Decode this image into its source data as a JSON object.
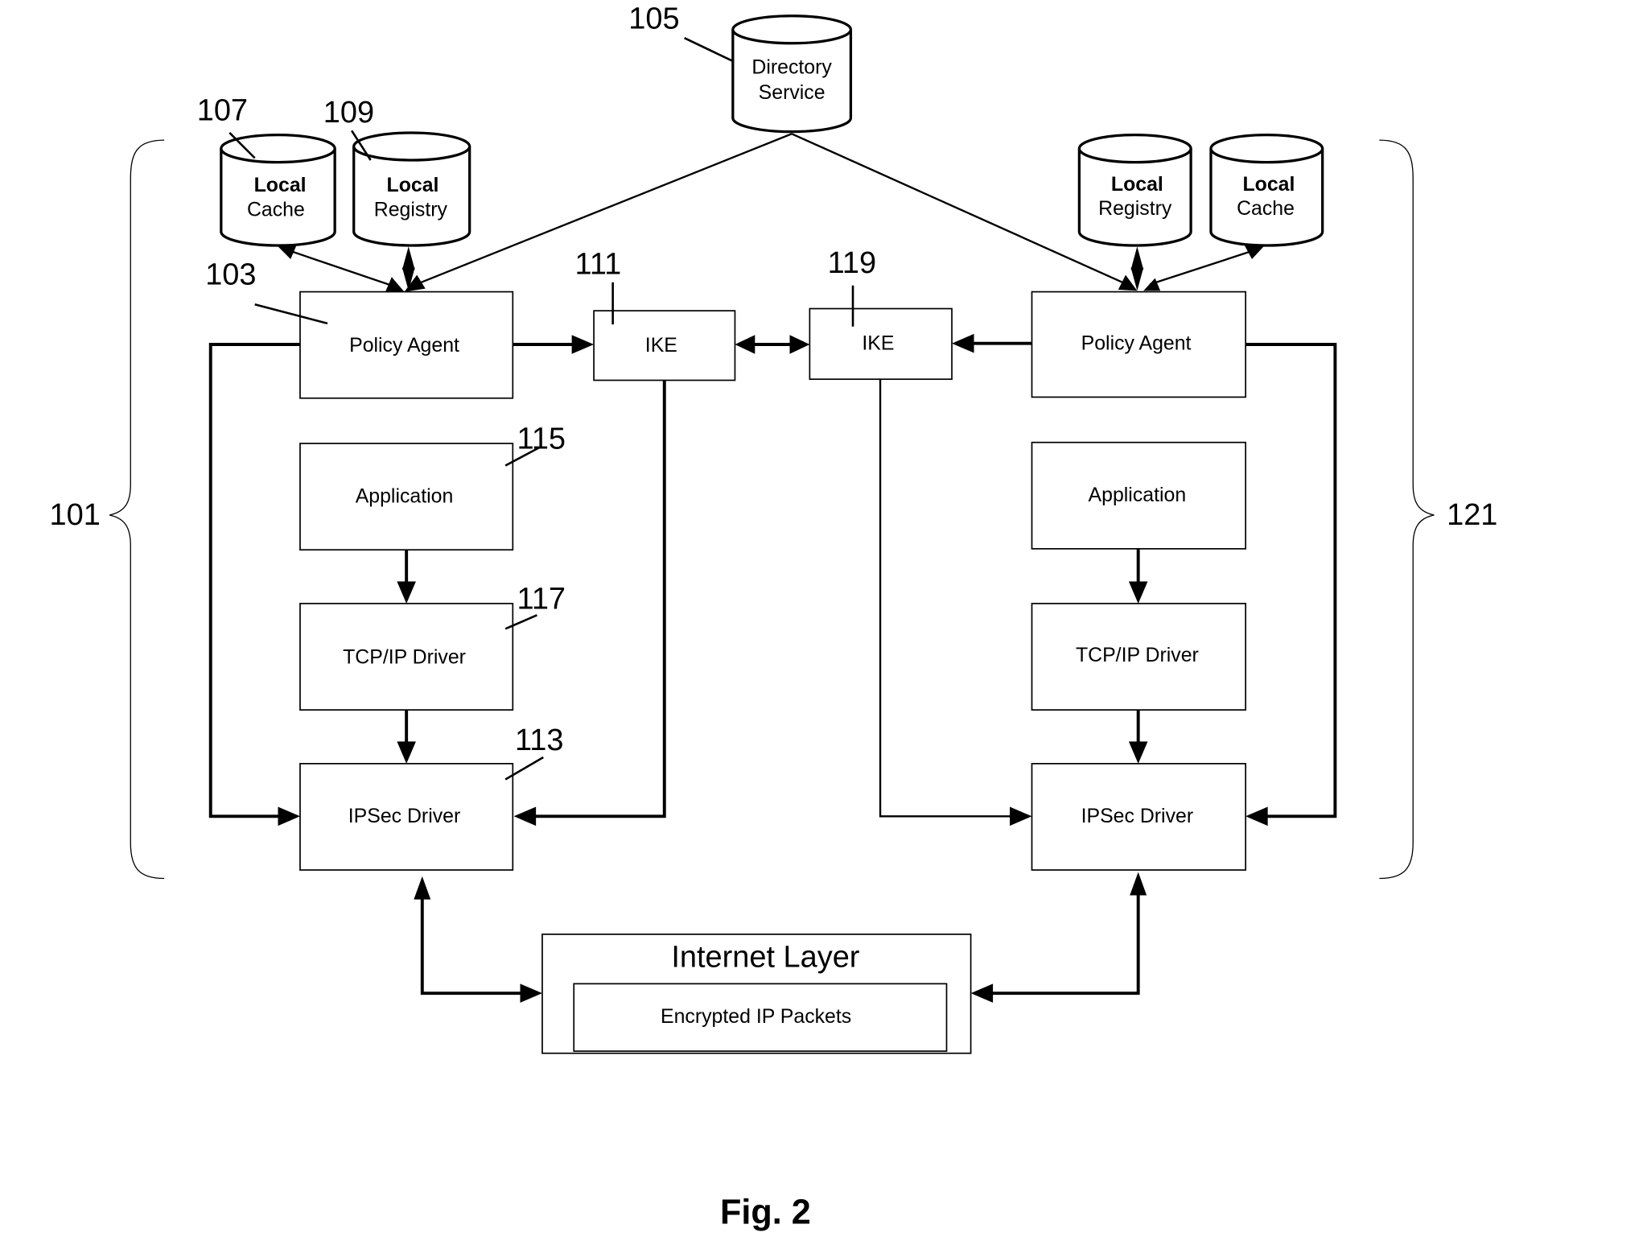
{
  "figure": {
    "caption": "Fig. 2",
    "directory_service": {
      "ref": "105",
      "line1": "Directory",
      "line2": "Service"
    },
    "left_system": {
      "ref": "101",
      "local_cache": {
        "ref": "107",
        "line1": "Local",
        "line2": "Cache"
      },
      "local_registry": {
        "ref": "109",
        "line1": "Local",
        "line2": "Registry"
      },
      "policy_agent": {
        "ref": "103",
        "label": "Policy Agent"
      },
      "ike": {
        "ref": "111",
        "label": "IKE"
      },
      "application": {
        "ref": "115",
        "label": "Application"
      },
      "tcpip_driver": {
        "ref": "117",
        "label": "TCP/IP Driver"
      },
      "ipsec_driver": {
        "ref": "113",
        "label": "IPSec Driver"
      }
    },
    "right_system": {
      "ref": "121",
      "local_registry": {
        "line1": "Local",
        "line2": "Registry"
      },
      "local_cache": {
        "line1": "Local",
        "line2": "Cache"
      },
      "policy_agent": {
        "label": "Policy Agent"
      },
      "ike": {
        "ref": "119",
        "label": "IKE"
      },
      "application": {
        "label": "Application"
      },
      "tcpip_driver": {
        "label": "TCP/IP Driver"
      },
      "ipsec_driver": {
        "label": "IPSec Driver"
      }
    },
    "internet_layer": {
      "title": "Internet Layer",
      "inner_label": "Encrypted IP Packets"
    }
  }
}
